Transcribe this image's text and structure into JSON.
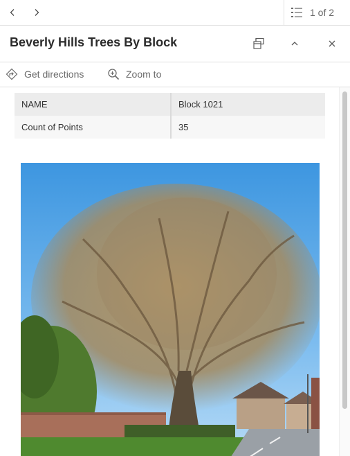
{
  "topbar": {
    "prev_icon": "chevron-left-icon",
    "next_icon": "chevron-right-icon",
    "list_icon": "list-icon",
    "count": "1 of 2"
  },
  "header": {
    "title": "Beverly Hills Trees By Block",
    "dock_icon": "dock-icon",
    "collapse_icon": "chevron-up-icon",
    "close_icon": "close-icon"
  },
  "actions": {
    "directions_label": "Get directions",
    "directions_icon": "directions-icon",
    "zoom_label": "Zoom to",
    "zoom_icon": "zoom-in-icon"
  },
  "attributes": [
    {
      "key": "NAME",
      "value": "Block 1021"
    },
    {
      "key": "Count of Points",
      "value": "35"
    }
  ],
  "colors": {
    "text": "#323232",
    "muted": "#6a6a6a",
    "border": "#e0e0e0",
    "sky": "#5fa8e6"
  }
}
